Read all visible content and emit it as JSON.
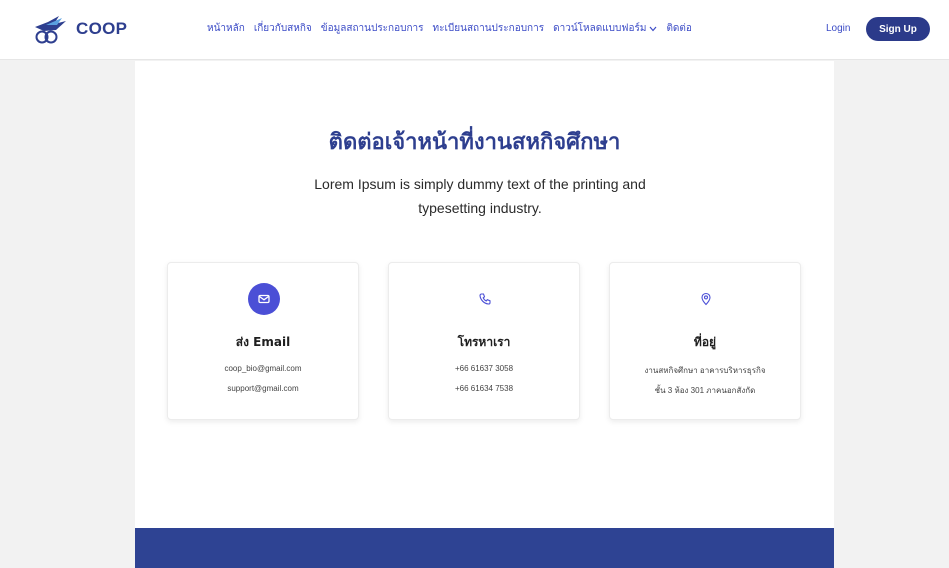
{
  "brand": {
    "name": "COOP"
  },
  "nav": {
    "items": [
      "หน้าหลัก",
      "เกี่ยวกับสหกิจ",
      "ข้อมูลสถานประกอบการ",
      "ทะเบียนสถานประกอบการ",
      "ดาวน์โหลดแบบฟอร์ม",
      "ติดต่อ"
    ],
    "login_label": "Login",
    "signup_label": "Sign Up"
  },
  "hero": {
    "title": "ติดต่อเจ้าหน้าที่งานสหกิจศึกษา",
    "subtitle_line1": "Lorem Ipsum is simply dummy text of the printing and",
    "subtitle_line2": "typesetting industry."
  },
  "cards": [
    {
      "icon": "envelope-icon",
      "title": "ส่ง Email",
      "line1": "coop_bio@gmail.com",
      "line2": "support@gmail.com"
    },
    {
      "icon": "phone-icon",
      "title": "โทรหาเรา",
      "line1": "+66 61637 3058",
      "line2": "+66 61634 7538"
    },
    {
      "icon": "location-pin-icon",
      "title": "ที่อยู่",
      "line1": "งานสหกิจศึกษา อาคารบริหารธุรกิจ",
      "line2": "ชั้น 3 ห้อง 301 ภาคนอกสังกัด"
    }
  ],
  "colors": {
    "primary": "#2e3f8f",
    "accent": "#4b4fd6",
    "nav_text": "#3b4bc6",
    "footer": "#2e4393",
    "background": "#f2f2f2"
  }
}
